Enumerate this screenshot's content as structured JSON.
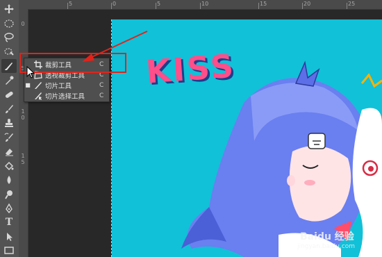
{
  "ruler": {
    "top_numbers": [
      "5",
      "0",
      "5",
      "10",
      "15",
      "20",
      "25"
    ],
    "left_numbers": [
      "0",
      "5",
      "1",
      "0",
      "1",
      "5"
    ]
  },
  "toolbar": {
    "tools": [
      {
        "name": "move-tool",
        "icon": "move-icon"
      },
      {
        "name": "marquee-tool",
        "icon": "ellipse-marquee-icon"
      },
      {
        "name": "lasso-tool",
        "icon": "lasso-icon"
      },
      {
        "name": "quick-select-tool",
        "icon": "quick-selection-icon"
      },
      {
        "name": "crop-tool",
        "icon": "slice-knife-icon"
      },
      {
        "name": "eyedropper-tool",
        "icon": "eyedropper-icon"
      },
      {
        "name": "healing-tool",
        "icon": "bandage-icon"
      },
      {
        "name": "brush-tool",
        "icon": "brush-icon"
      },
      {
        "name": "stamp-tool",
        "icon": "stamp-icon"
      },
      {
        "name": "history-brush-tool",
        "icon": "history-brush-icon"
      },
      {
        "name": "eraser-tool",
        "icon": "eraser-icon"
      },
      {
        "name": "paint-bucket-tool",
        "icon": "paint-bucket-icon"
      },
      {
        "name": "blur-tool",
        "icon": "drop-icon"
      },
      {
        "name": "dodge-tool",
        "icon": "dodge-icon"
      },
      {
        "name": "pen-tool",
        "icon": "pen-icon"
      },
      {
        "name": "type-tool",
        "icon": "type-icon"
      },
      {
        "name": "path-select-tool",
        "icon": "arrow-icon"
      },
      {
        "name": "shape-tool",
        "icon": "rectangle-icon"
      }
    ],
    "type_glyph": "T"
  },
  "flyout": {
    "items": [
      {
        "label": "裁剪工具",
        "shortcut": "C",
        "selected": false
      },
      {
        "label": "透视裁剪工具",
        "shortcut": "C",
        "selected": false
      },
      {
        "label": "切片工具",
        "shortcut": "C",
        "selected": true
      },
      {
        "label": "切片选择工具",
        "shortcut": "C",
        "selected": false
      }
    ],
    "selected_mark": "■"
  },
  "canvas": {
    "title_text": "KISS",
    "background": "#11c1d8"
  },
  "annotation": {
    "highlight_color": "#e2231a"
  },
  "watermark": {
    "brand": "Baidu 经验",
    "url": "jingyan.baidu.com"
  }
}
